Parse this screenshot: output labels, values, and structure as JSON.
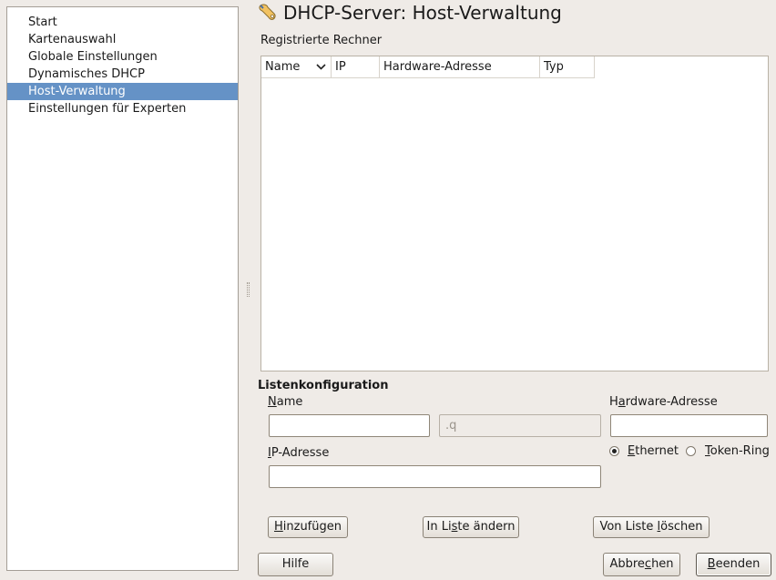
{
  "nav": {
    "items": [
      {
        "label": "Start"
      },
      {
        "label": "Kartenauswahl"
      },
      {
        "label": "Globale Einstellungen"
      },
      {
        "label": "Dynamisches DHCP"
      },
      {
        "label": "Host-Verwaltung",
        "selected": true
      },
      {
        "label": "Einstellungen für Experten"
      }
    ]
  },
  "header": {
    "title": "DHCP-Server: Host-Verwaltung"
  },
  "hosts": {
    "label": "Registrierte Rechner",
    "columns": [
      "Name",
      "IP",
      "Hardware-Adresse",
      "Typ"
    ],
    "rows": []
  },
  "config": {
    "title": "Listenkonfiguration",
    "name_label": "Name",
    "name_value": "",
    "domain_value": ".q",
    "hw_label": "Hardware-Adresse",
    "hw_value": "",
    "ip_label": "IP-Adresse",
    "ip_value": "",
    "radio_ethernet": "Ethernet",
    "radio_token": "Token-Ring",
    "selected_type": "Ethernet"
  },
  "actions": {
    "add": "Hinzufügen",
    "change": "In Liste ändern",
    "delete": "Von Liste löschen"
  },
  "footer": {
    "help": "Hilfe",
    "cancel": "Abbrechen",
    "finish": "Beenden"
  },
  "colors": {
    "selection": "#6592c6",
    "window": "#efebe7"
  }
}
